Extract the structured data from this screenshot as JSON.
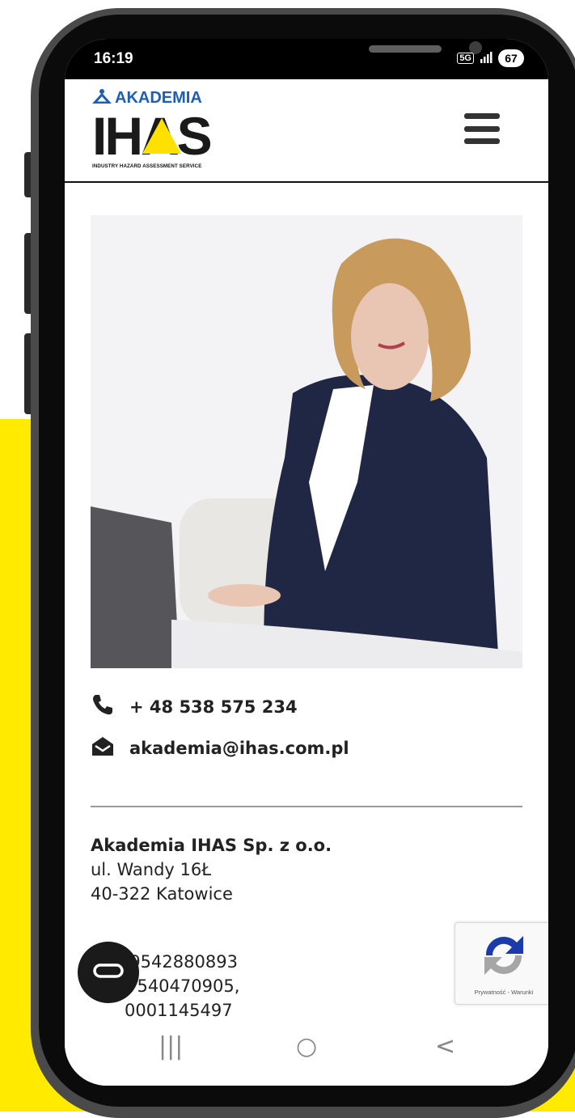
{
  "status_bar": {
    "time": "16:19",
    "network": "5G",
    "signal_icon": "signal-bars-icon",
    "battery": "67"
  },
  "header": {
    "logo_top_text": "AKADEMIA",
    "logo_main_text": "IHAS",
    "logo_subtitle": "INDUSTRY HAZARD ASSESSMENT SERVICE",
    "menu_icon": "hamburger-menu-icon"
  },
  "contact": {
    "phone": "+ 48 538 575 234",
    "email": "akademia@ihas.com.pl"
  },
  "company": {
    "name": "Akademia IHAS Sp. z o.o.",
    "street": "ul. Wandy 16Ł",
    "city": "40-322 Katowice"
  },
  "tax": {
    "nip_visible": "NIP: 9542880893",
    "regon_visible": "N: 540470905,",
    "krs_visible": "0001145497"
  },
  "recaptcha": {
    "label": "Prywatność - Warunki"
  },
  "nav": {
    "recent": "|||",
    "home": "○",
    "back": "<"
  },
  "colors": {
    "brand_yellow": "#ffea00",
    "brand_blue": "#1e5fb4",
    "text_dark": "#222222"
  }
}
